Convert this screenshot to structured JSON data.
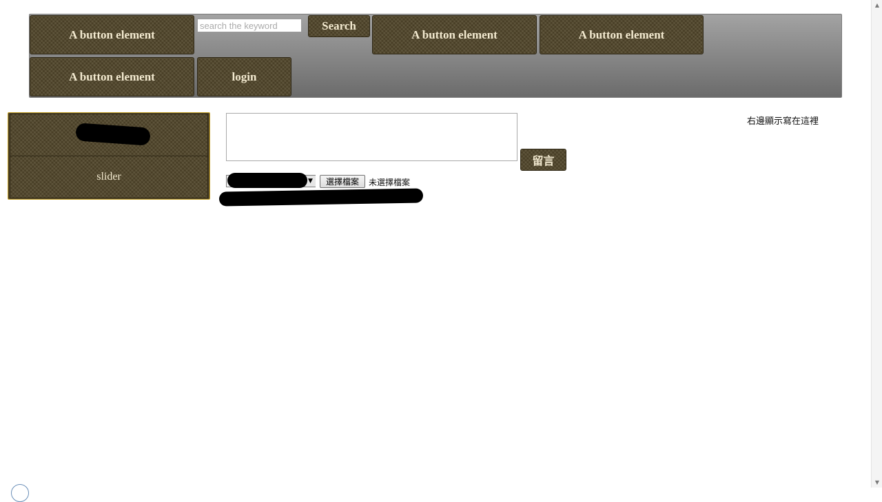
{
  "navbar": {
    "buttons": [
      {
        "label": "A button element"
      },
      {
        "label": "A button element"
      },
      {
        "label": "A button element"
      },
      {
        "label": "A button element"
      },
      {
        "label": "login"
      }
    ],
    "search": {
      "placeholder": "search the keyword",
      "button_label": "Search"
    }
  },
  "sidebar": {
    "items": [
      {
        "label": ""
      },
      {
        "label": "slider"
      }
    ]
  },
  "comment": {
    "textarea_value": "",
    "submit_label": "留言"
  },
  "upload": {
    "select_value": "",
    "file_button_label": "選擇檔案",
    "file_status": "未選擇檔案",
    "hint_text": ""
  },
  "right_panel": {
    "text": "右邊顯示寫在這裡"
  }
}
